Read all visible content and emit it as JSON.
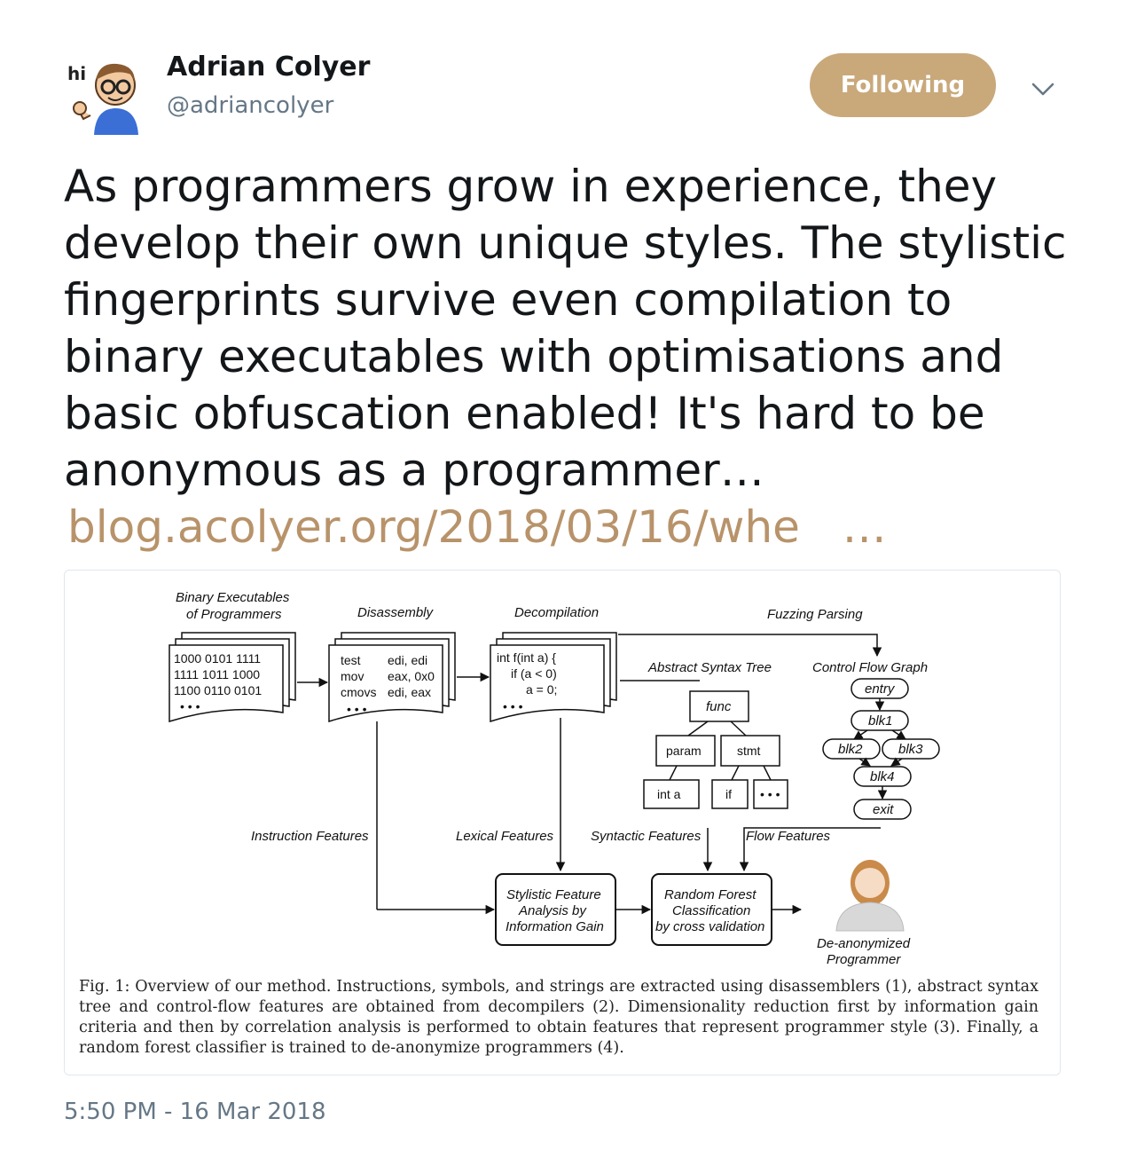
{
  "tweet": {
    "author_name": "Adrian Colyer",
    "author_handle": "@adriancolyer",
    "avatar_greeting": "hi",
    "follow_button_label": "Following",
    "text": "As programmers grow in experience, they develop their own unique styles. The stylistic fingerprints survive even compilation to binary executables with optimisations and basic obfuscation enabled! It's hard to be anonymous as a programmer…",
    "link_text": "blog.acolyer.org/2018/03/16/whe   …",
    "timestamp": "5:50 PM - 16 Mar 2018"
  },
  "figure": {
    "stage_binary": "Binary Executables",
    "stage_binary_2": "of Programmers",
    "stage_disassembly": "Disassembly",
    "stage_decompilation": "Decompilation",
    "stage_fuzzing": "Fuzzing Parsing",
    "binary_lines": [
      "1000 0101 1111",
      "1111 1011 1000",
      "1100 0110 0101",
      "• • •"
    ],
    "asm_lines": [
      {
        "op": "test",
        "args": "edi, edi"
      },
      {
        "op": "mov",
        "args": "eax, 0x0"
      },
      {
        "op": "cmovs",
        "args": "edi, eax"
      }
    ],
    "asm_more": "• • •",
    "code_lines": [
      "int f(int a) {",
      "if (a < 0)",
      "a = 0;",
      "• • •"
    ],
    "ast_title": "Abstract Syntax Tree",
    "ast_nodes": {
      "root": "func",
      "left": "param",
      "right": "stmt",
      "leaf1": "int a",
      "leaf2": "if",
      "leaf3": "• • •"
    },
    "cfg_title": "Control Flow Graph",
    "cfg_nodes": {
      "entry": "entry",
      "b1": "blk1",
      "b2": "blk2",
      "b3": "blk3",
      "b4": "blk4",
      "exit": "exit"
    },
    "feat_instruction": "Instruction Features",
    "feat_lexical": "Lexical Features",
    "feat_syntactic": "Syntactic Features",
    "feat_flow": "Flow Features",
    "box_stylistic": [
      "Stylistic Feature",
      "Analysis by",
      "Information Gain"
    ],
    "box_rf": [
      "Random Forest",
      "Classification",
      "by cross validation"
    ],
    "result_label": [
      "De-anonymized",
      "Programmer"
    ],
    "caption": "Fig. 1: Overview of our method. Instructions, symbols, and strings are extracted using disassemblers (1), abstract syntax tree and control-flow features are obtained from decompilers (2). Dimensionality reduction first by information gain criteria and then by correlation analysis is performed to obtain features that represent programmer style (3). Finally, a random forest classifier is trained to de-anonymize programmers (4)."
  },
  "colors": {
    "accent": "#c9a87a",
    "link": "#b8936a",
    "secondary_text": "#657786"
  }
}
